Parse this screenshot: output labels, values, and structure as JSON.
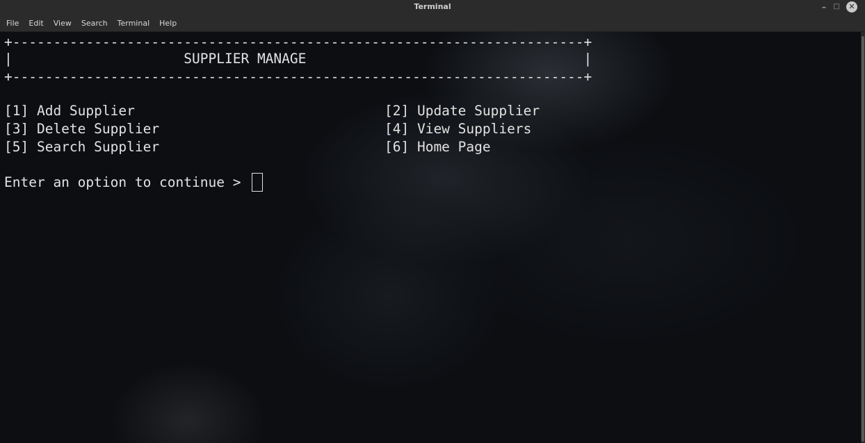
{
  "window": {
    "title": "Terminal",
    "minimize_glyph": "–",
    "maximize_glyph": "□",
    "close_glyph": "✕"
  },
  "menu": [
    "File",
    "Edit",
    "View",
    "Search",
    "Terminal",
    "Help"
  ],
  "terminal": {
    "border_top": "+----------------------------------------------------------------------+",
    "header_line": "|                     SUPPLIER MANAGE                                  |",
    "border_bottom": "+----------------------------------------------------------------------+",
    "options": [
      {
        "left": "[1] Add Supplier",
        "right": "[2] Update Supplier"
      },
      {
        "left": "[3] Delete Supplier",
        "right": "[4] View Suppliers"
      },
      {
        "left": "[5] Search Supplier",
        "right": "[6] Home Page"
      }
    ],
    "prompt": "Enter an option to continue > "
  },
  "colors": {
    "text": "#e2e2e2",
    "background": "#0c0e12",
    "chrome": "#2b2b2b"
  }
}
